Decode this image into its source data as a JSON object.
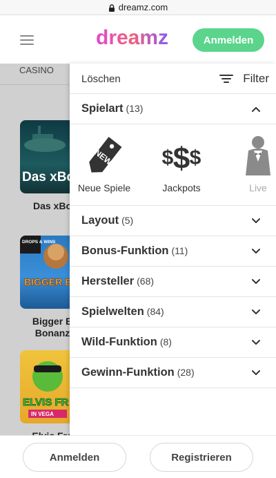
{
  "browser": {
    "url": "dreamz.com"
  },
  "header": {
    "logo_text": "dreamz",
    "login_label": "Anmelden"
  },
  "content": {
    "tab_label": "CASINO",
    "games": [
      {
        "title": "Das xBo",
        "thumb_text": "Das xBo",
        "theme": "#1d4a4e"
      },
      {
        "title": "Bigger B",
        "title2": "Bonanz",
        "thumb_text": "BIGGER BASS",
        "badge": "DROPS & WINS",
        "theme": "#2a6db0"
      },
      {
        "title": "Elvis Fro",
        "thumb_text": "ELVIS FR",
        "sub_text": "IN VEGA",
        "theme": "#e8b92a"
      }
    ]
  },
  "drawer": {
    "clear_label": "Löschen",
    "filter_label": "Filter",
    "expanded": {
      "label": "Spielart",
      "count": "(13)"
    },
    "categories": [
      {
        "label": "Neue Spiele",
        "icon": "new-tag-icon",
        "muted": false
      },
      {
        "label": "Jackpots",
        "icon": "dollar-signs-icon",
        "muted": false
      },
      {
        "label": "Live",
        "icon": "butler-icon",
        "muted": true
      }
    ],
    "sections": [
      {
        "label": "Layout",
        "count": "(5)"
      },
      {
        "label": "Bonus-Funktion",
        "count": "(11)"
      },
      {
        "label": "Hersteller",
        "count": "(68)"
      },
      {
        "label": "Spielwelten",
        "count": "(84)"
      },
      {
        "label": "Wild-Funktion",
        "count": "(8)"
      },
      {
        "label": "Gewinn-Funktion",
        "count": "(28)"
      }
    ]
  },
  "footer": {
    "login_label": "Anmelden",
    "register_label": "Registrieren"
  },
  "colors": {
    "accent_green": "#5bd48c"
  }
}
